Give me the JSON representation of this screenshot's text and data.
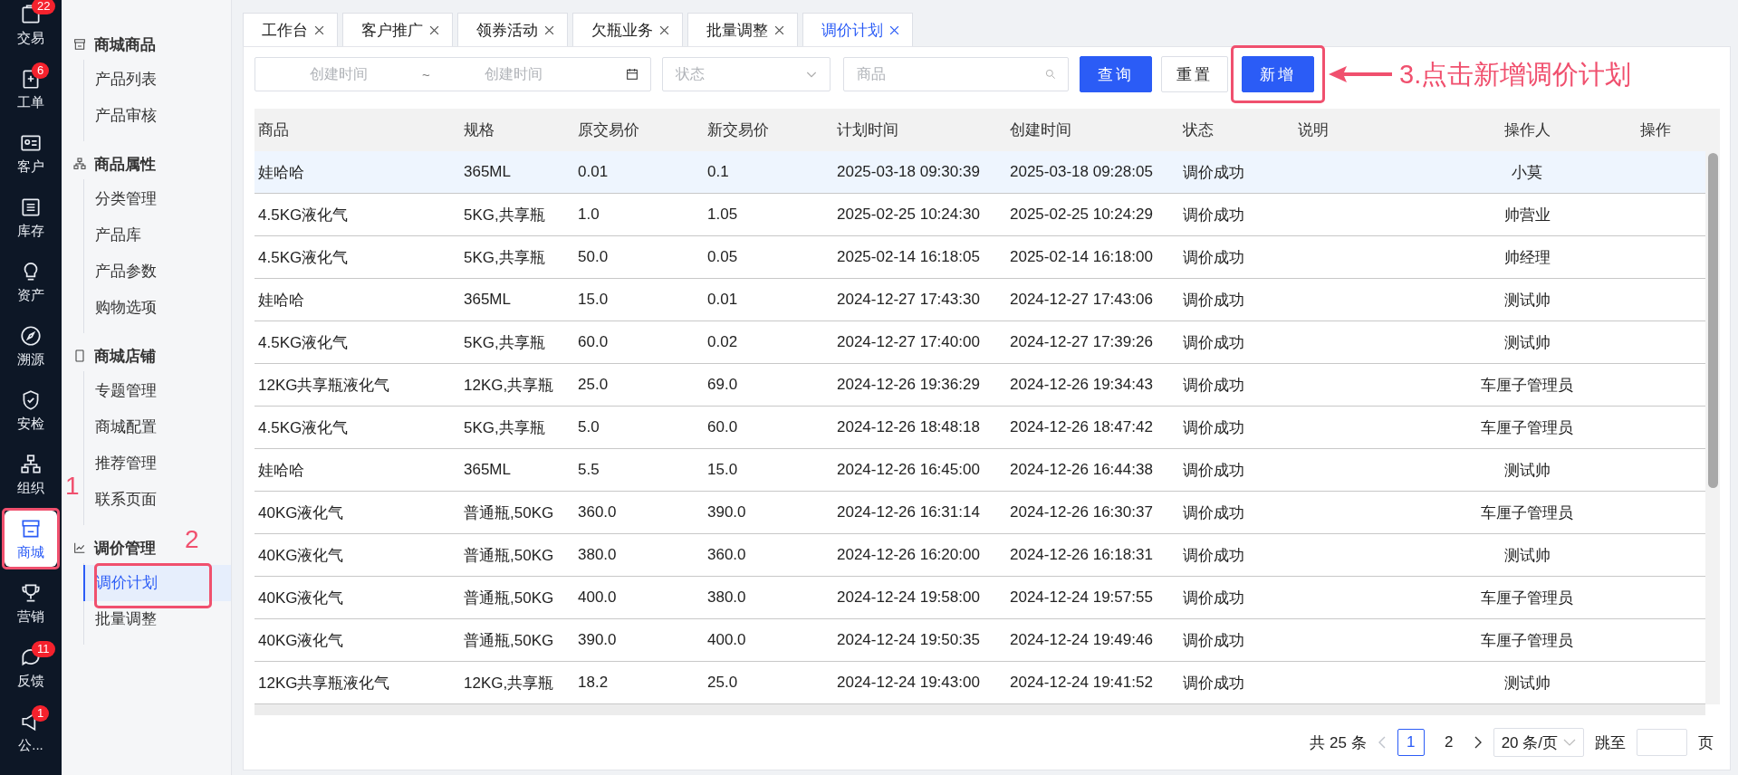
{
  "nav": [
    {
      "label": "交易",
      "badge": "22",
      "selected": false
    },
    {
      "label": "工单",
      "badge": "6",
      "selected": false
    },
    {
      "label": "客户",
      "selected": false
    },
    {
      "label": "库存",
      "selected": false
    },
    {
      "label": "资产",
      "selected": false
    },
    {
      "label": "溯源",
      "selected": false
    },
    {
      "label": "安检",
      "selected": false
    },
    {
      "label": "组织",
      "selected": false
    },
    {
      "label": "商城",
      "selected": true
    },
    {
      "label": "营销",
      "selected": false
    },
    {
      "label": "反馈",
      "badge": "11",
      "selected": false
    },
    {
      "label": "公...",
      "badge": "1",
      "selected": false
    }
  ],
  "sidebar": {
    "groups": [
      {
        "title": "商城商品",
        "items": [
          {
            "label": "产品列表",
            "selected": false
          },
          {
            "label": "产品审核",
            "selected": false
          }
        ]
      },
      {
        "title": "商品属性",
        "items": [
          {
            "label": "分类管理",
            "selected": false
          },
          {
            "label": "产品库",
            "selected": false
          },
          {
            "label": "产品参数",
            "selected": false
          },
          {
            "label": "购物选项",
            "selected": false
          }
        ]
      },
      {
        "title": "商城店铺",
        "items": [
          {
            "label": "专题管理",
            "selected": false
          },
          {
            "label": "商城配置",
            "selected": false
          },
          {
            "label": "推荐管理",
            "selected": false
          },
          {
            "label": "联系页面",
            "selected": false
          }
        ]
      },
      {
        "title": "调价管理",
        "items": [
          {
            "label": "调价计划",
            "selected": true
          },
          {
            "label": "批量调整",
            "selected": false
          }
        ]
      }
    ]
  },
  "tabs": [
    {
      "label": "工作台",
      "selected": false
    },
    {
      "label": "客户推广",
      "selected": false
    },
    {
      "label": "领券活动",
      "selected": false
    },
    {
      "label": "欠瓶业务",
      "selected": false
    },
    {
      "label": "批量调整",
      "selected": false
    },
    {
      "label": "调价计划",
      "selected": true
    }
  ],
  "filters": {
    "date_start": {
      "placeholder": "创建时间"
    },
    "separator": "~",
    "date_end": {
      "placeholder": "创建时间"
    },
    "status": {
      "placeholder": "状态"
    },
    "product": {
      "placeholder": "商品"
    },
    "buttons": [
      {
        "label": "查询",
        "kind": "primary"
      },
      {
        "label": "重置",
        "kind": "default"
      },
      {
        "label": "新增",
        "kind": "primary"
      }
    ]
  },
  "table": {
    "columns": [
      "商品",
      "规格",
      "原交易价",
      "新交易价",
      "计划时间",
      "创建时间",
      "状态",
      "说明",
      "操作人",
      "操作"
    ],
    "rows": [
      {
        "selected": true,
        "cells": [
          "娃哈哈",
          "365ML",
          "0.01",
          "0.1",
          "2025-03-18 09:30:39",
          "2025-03-18 09:28:05",
          "调价成功",
          "",
          "小莫",
          ""
        ]
      },
      {
        "selected": false,
        "cells": [
          "4.5KG液化气",
          "5KG,共享瓶",
          "1.0",
          "1.05",
          "2025-02-25 10:24:30",
          "2025-02-25 10:24:29",
          "调价成功",
          "",
          "帅营业",
          ""
        ]
      },
      {
        "selected": false,
        "cells": [
          "4.5KG液化气",
          "5KG,共享瓶",
          "50.0",
          "0.05",
          "2025-02-14 16:18:05",
          "2025-02-14 16:18:00",
          "调价成功",
          "",
          "帅经理",
          ""
        ]
      },
      {
        "selected": false,
        "cells": [
          "娃哈哈",
          "365ML",
          "15.0",
          "0.01",
          "2024-12-27 17:43:30",
          "2024-12-27 17:43:06",
          "调价成功",
          "",
          "测试帅",
          ""
        ]
      },
      {
        "selected": false,
        "cells": [
          "4.5KG液化气",
          "5KG,共享瓶",
          "60.0",
          "0.02",
          "2024-12-27 17:40:00",
          "2024-12-27 17:39:26",
          "调价成功",
          "",
          "测试帅",
          ""
        ]
      },
      {
        "selected": false,
        "cells": [
          "12KG共享瓶液化气",
          "12KG,共享瓶",
          "25.0",
          "69.0",
          "2024-12-26 19:36:29",
          "2024-12-26 19:34:43",
          "调价成功",
          "",
          "车厘子管理员",
          ""
        ]
      },
      {
        "selected": false,
        "cells": [
          "4.5KG液化气",
          "5KG,共享瓶",
          "5.0",
          "60.0",
          "2024-12-26 18:48:18",
          "2024-12-26 18:47:42",
          "调价成功",
          "",
          "车厘子管理员",
          ""
        ]
      },
      {
        "selected": false,
        "cells": [
          "娃哈哈",
          "365ML",
          "5.5",
          "15.0",
          "2024-12-26 16:45:00",
          "2024-12-26 16:44:38",
          "调价成功",
          "",
          "测试帅",
          ""
        ]
      },
      {
        "selected": false,
        "cells": [
          "40KG液化气",
          "普通瓶,50KG",
          "360.0",
          "390.0",
          "2024-12-26 16:31:14",
          "2024-12-26 16:30:37",
          "调价成功",
          "",
          "车厘子管理员",
          ""
        ]
      },
      {
        "selected": false,
        "cells": [
          "40KG液化气",
          "普通瓶,50KG",
          "380.0",
          "360.0",
          "2024-12-26 16:20:00",
          "2024-12-26 16:18:31",
          "调价成功",
          "",
          "测试帅",
          ""
        ]
      },
      {
        "selected": false,
        "cells": [
          "40KG液化气",
          "普通瓶,50KG",
          "400.0",
          "380.0",
          "2024-12-24 19:58:00",
          "2024-12-24 19:57:55",
          "调价成功",
          "",
          "车厘子管理员",
          ""
        ]
      },
      {
        "selected": false,
        "cells": [
          "40KG液化气",
          "普通瓶,50KG",
          "390.0",
          "400.0",
          "2024-12-24 19:50:35",
          "2024-12-24 19:49:46",
          "调价成功",
          "",
          "车厘子管理员",
          ""
        ]
      },
      {
        "selected": false,
        "cells": [
          "12KG共享瓶液化气",
          "12KG,共享瓶",
          "18.2",
          "25.0",
          "2024-12-24 19:43:00",
          "2024-12-24 19:41:52",
          "调价成功",
          "",
          "测试帅",
          ""
        ]
      }
    ]
  },
  "pagination": {
    "total": "共 25 条",
    "pages": [
      {
        "label": "1",
        "selected": true
      },
      {
        "label": "2",
        "selected": false
      }
    ],
    "page_size": "20 条/页",
    "jump_label": "跳至",
    "page_unit": "页"
  },
  "annotations": [
    {
      "label": "1"
    },
    {
      "label": "2"
    },
    {
      "label": "3.点击新增调价计划"
    }
  ]
}
